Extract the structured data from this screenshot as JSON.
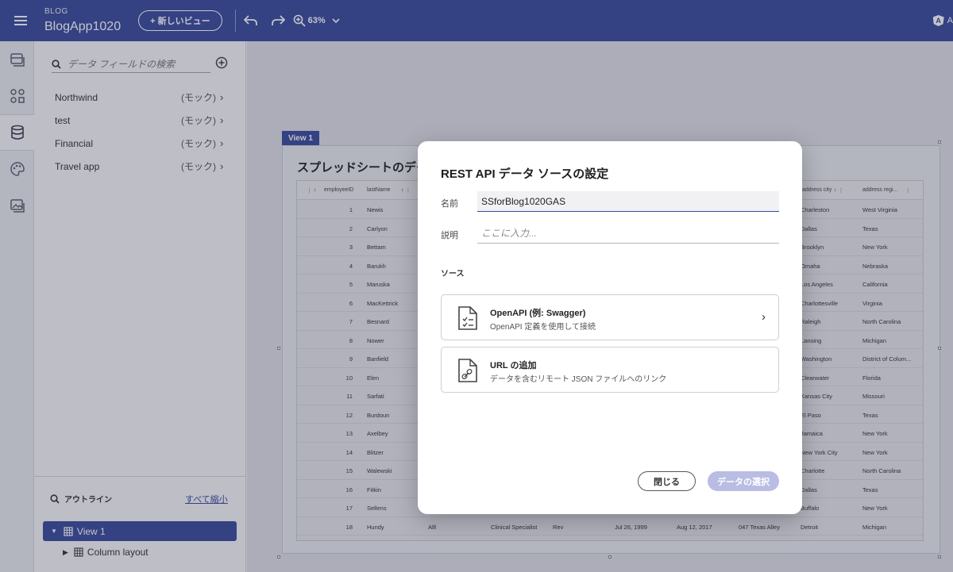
{
  "header": {
    "kicker": "BLOG",
    "app_name": "BlogApp1020",
    "new_view_label": "+ 新しいビュー",
    "zoom": "63%",
    "right_text": "A"
  },
  "data_panel": {
    "search_placeholder": "データ フィールドの検索",
    "sources": [
      {
        "name": "Northwind",
        "tag": "(モック)"
      },
      {
        "name": "test",
        "tag": "(モック)"
      },
      {
        "name": "Financial",
        "tag": "(モック)"
      },
      {
        "name": "Travel app",
        "tag": "(モック)"
      }
    ]
  },
  "outline": {
    "title": "アウトライン",
    "collapse_all": "すべて縮小",
    "items": [
      {
        "label": "View 1"
      },
      {
        "label": "Column layout"
      }
    ]
  },
  "canvas": {
    "view_tab": "View 1",
    "view_title": "スプレッドシートのデー",
    "sheet": {
      "headers": [
        "employeeID",
        "lastName",
        "address city",
        "address regi..."
      ],
      "rows": [
        {
          "id": "1",
          "last": "Newis",
          "city": "Charleston",
          "region": "West Virginia"
        },
        {
          "id": "2",
          "last": "Carlyon",
          "city": "Dallas",
          "region": "Texas"
        },
        {
          "id": "3",
          "last": "Bettam",
          "city": "Brooklyn",
          "region": "New York"
        },
        {
          "id": "4",
          "last": "Barukh",
          "city": "Omaha",
          "region": "Nebraska"
        },
        {
          "id": "5",
          "last": "Maruska",
          "city": "Los Angeles",
          "region": "California"
        },
        {
          "id": "6",
          "last": "MacKettrick",
          "city": "Charlottesville",
          "region": "Virginia"
        },
        {
          "id": "7",
          "last": "Besnard",
          "city": "Raleigh",
          "region": "North Carolina"
        },
        {
          "id": "8",
          "last": "Nower",
          "city": "Lansing",
          "region": "Michigan"
        },
        {
          "id": "9",
          "last": "Banfield",
          "city": "Washington",
          "region": "District of Colum..."
        },
        {
          "id": "10",
          "last": "Elen",
          "city": "Clearwater",
          "region": "Florida"
        },
        {
          "id": "11",
          "last": "Sarfati",
          "city": "Kansas City",
          "region": "Missouri"
        },
        {
          "id": "12",
          "last": "Burdoun",
          "city": "El Paso",
          "region": "Texas"
        },
        {
          "id": "13",
          "last": "Axelbey",
          "city": "Jamaica",
          "region": "New York"
        },
        {
          "id": "14",
          "last": "Blitzer",
          "city": "New York City",
          "region": "New York"
        },
        {
          "id": "15",
          "last": "Walewski",
          "city": "Charlotte",
          "region": "North Carolina"
        },
        {
          "id": "16",
          "last": "Fitkin",
          "city": "Dallas",
          "region": "Texas"
        },
        {
          "id": "17",
          "last": "Sellens",
          "city": "Buffalo",
          "region": "New York"
        },
        {
          "id": "18",
          "last": "Hundy",
          "first": "Alfi",
          "title": "Clinical Specialist",
          "toc": "Rev",
          "birth": "Jul 26, 1999",
          "hire": "Aug 12, 2017",
          "address": "047 Texas Alley",
          "city": "Detroit",
          "region": "Michigan"
        }
      ]
    }
  },
  "modal": {
    "title": "REST API データ ソースの設定",
    "name_label": "名前",
    "name_value": "SSforBlog1020GAS",
    "desc_label": "説明",
    "desc_placeholder": "ここに入力...",
    "source_label": "ソース",
    "options": [
      {
        "title": "OpenAPI (例: Swagger)",
        "subtitle": "OpenAPI 定義を使用して接続",
        "icon": "file-checklist-icon"
      },
      {
        "title": "URL の追加",
        "subtitle": "データを含むリモート JSON ファイルへのリンク",
        "icon": "file-link-icon"
      }
    ],
    "close_label": "閉じる",
    "select_label": "データの選択"
  }
}
